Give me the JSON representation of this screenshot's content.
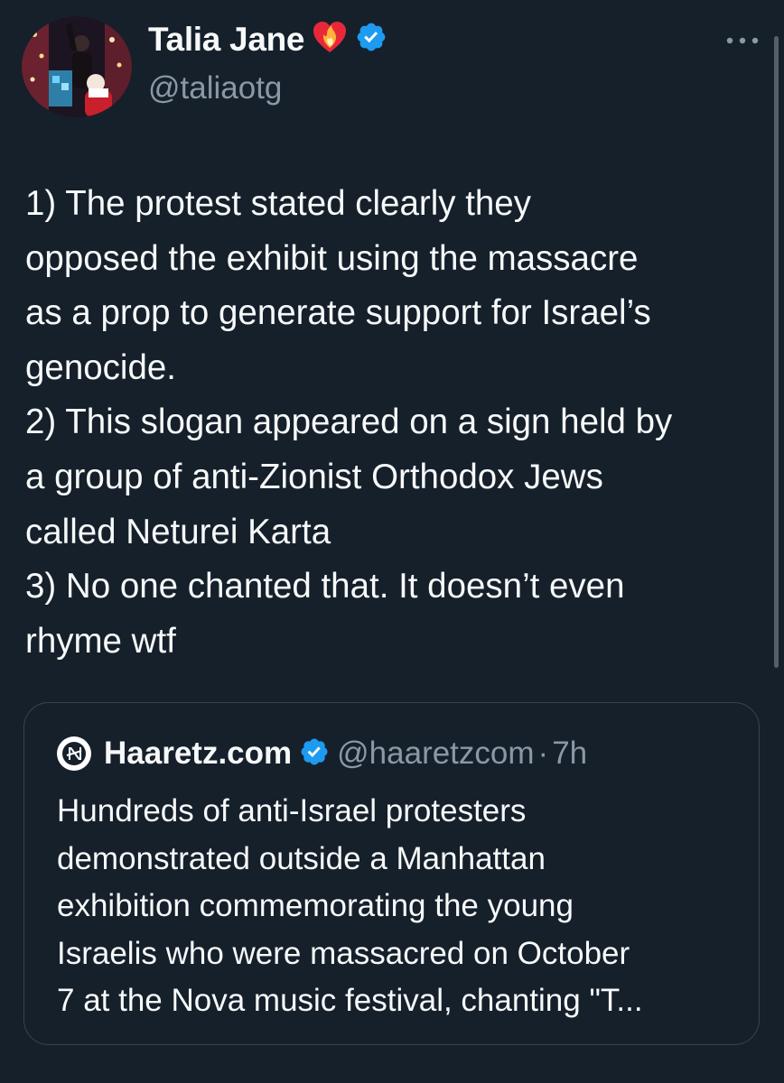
{
  "author": {
    "display_name": "Talia Jane",
    "handle": "@taliaotg",
    "emoji": "❤️‍🔥",
    "verified_icon": "verified-badge-icon"
  },
  "tweet": {
    "text_lines": [
      "1) The protest stated clearly they",
      "opposed the exhibit using the massacre",
      "as a prop to generate support for Israel’s",
      "genocide.",
      "2) This slogan appeared on a sign held by",
      "a group of anti-Zionist Orthodox Jews",
      "called Neturei Karta",
      "3) No one chanted that. It doesn’t even",
      "rhyme wtf"
    ]
  },
  "quote": {
    "display_name": "Haaretz.com",
    "handle": "@haaretzcom",
    "separator": "·",
    "time": "7h",
    "text_lines": [
      "Hundreds of anti-Israel protesters",
      "demonstrated outside a Manhattan",
      "exhibition commemorating the young",
      "Israelis who were massacred on October",
      "7 at the Nova music festival, chanting \"T..."
    ]
  },
  "colors": {
    "background": "#15202b",
    "text": "#f7f9f9",
    "secondary_text": "#8b98a5",
    "verified_blue": "#1d9bf0",
    "border": "#38444d"
  }
}
